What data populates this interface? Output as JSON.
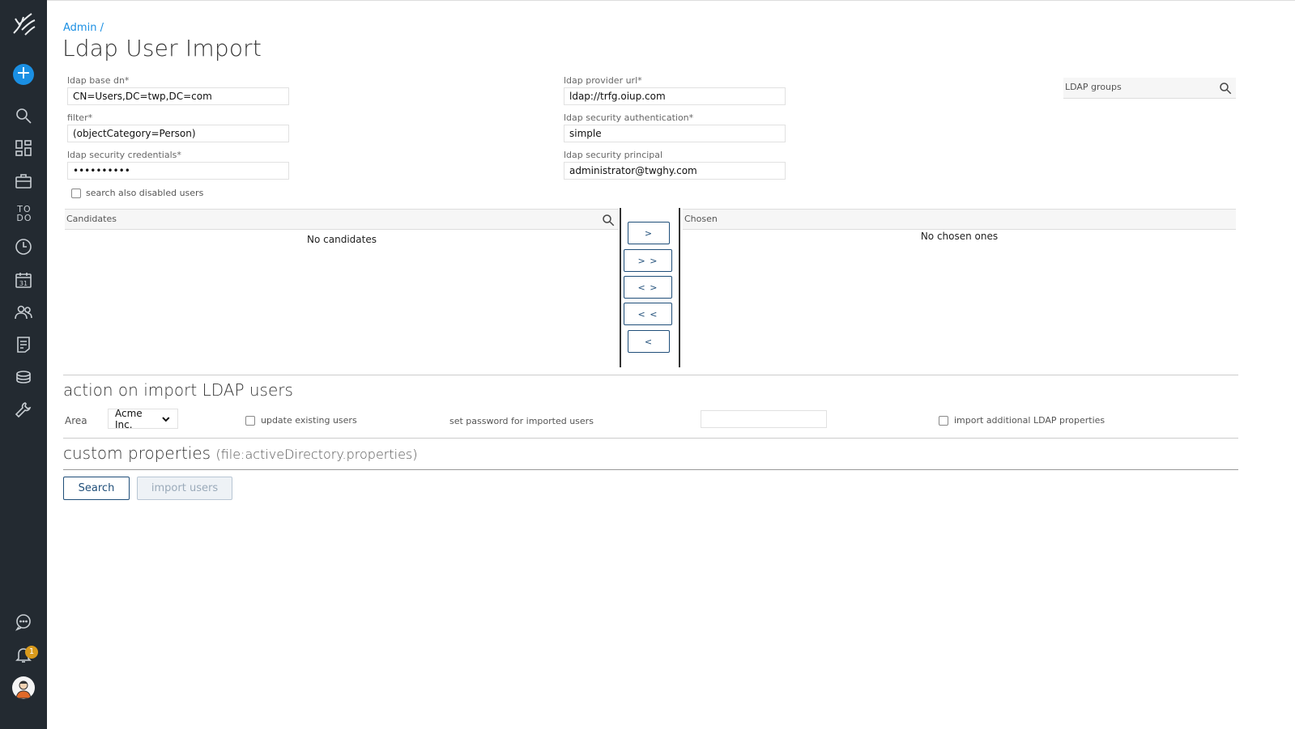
{
  "sidebar": {
    "icons": [
      "logo-icon",
      "add-icon",
      "search-icon",
      "dashboard-icon",
      "briefcase-icon",
      "todo-icon",
      "clock-icon",
      "calendar-icon",
      "users-icon",
      "document-icon",
      "coins-icon",
      "wrench-icon",
      "chat-icon",
      "bell-icon",
      "avatar-icon"
    ],
    "add_label": "+",
    "todo_label": "TO DO",
    "calendar_day": "31",
    "notification_count": "1"
  },
  "header": {
    "breadcrumb": "Admin /",
    "title": "Ldap User Import"
  },
  "form": {
    "base_dn": {
      "label": "ldap base dn*",
      "value": "CN=Users,DC=twp,DC=com"
    },
    "filter": {
      "label": "filter*",
      "value": "(objectCategory=Person)"
    },
    "credentials": {
      "label": "ldap security credentials*",
      "value": "••••••••••"
    },
    "provider_url": {
      "label": "ldap provider url*",
      "value": "ldap://trfg.oiup.com"
    },
    "authentication": {
      "label": "ldap security authentication*",
      "value": "simple"
    },
    "principal": {
      "label": "ldap security principal",
      "value": "administrator@twghy.com"
    },
    "disabled_users_label": "search also disabled users"
  },
  "ldap_groups": {
    "label": "LDAP groups"
  },
  "candidates": {
    "title": "Candidates",
    "empty": "No candidates"
  },
  "chosen": {
    "title": "Chosen",
    "empty": "No chosen ones"
  },
  "move_buttons": {
    "add_one": ">",
    "add_all": "> >",
    "swap": "< >",
    "remove_all": "< <",
    "remove_one": "<"
  },
  "import_action": {
    "title": "action on import LDAP users",
    "area_label": "Area",
    "area_value": "Acme Inc.",
    "update_existing_label": "update existing users",
    "set_password_label": "set password for imported users",
    "additional_props_label": "import additional LDAP properties"
  },
  "custom_properties": {
    "title": "custom properties",
    "file": "(file:activeDirectory.properties)"
  },
  "buttons": {
    "search": "Search",
    "import": "import users"
  },
  "colors": {
    "sidebar_bg": "#232a31",
    "accent": "#1a8fe3",
    "button_border": "#1f4e79",
    "badge": "#d99a1c"
  }
}
